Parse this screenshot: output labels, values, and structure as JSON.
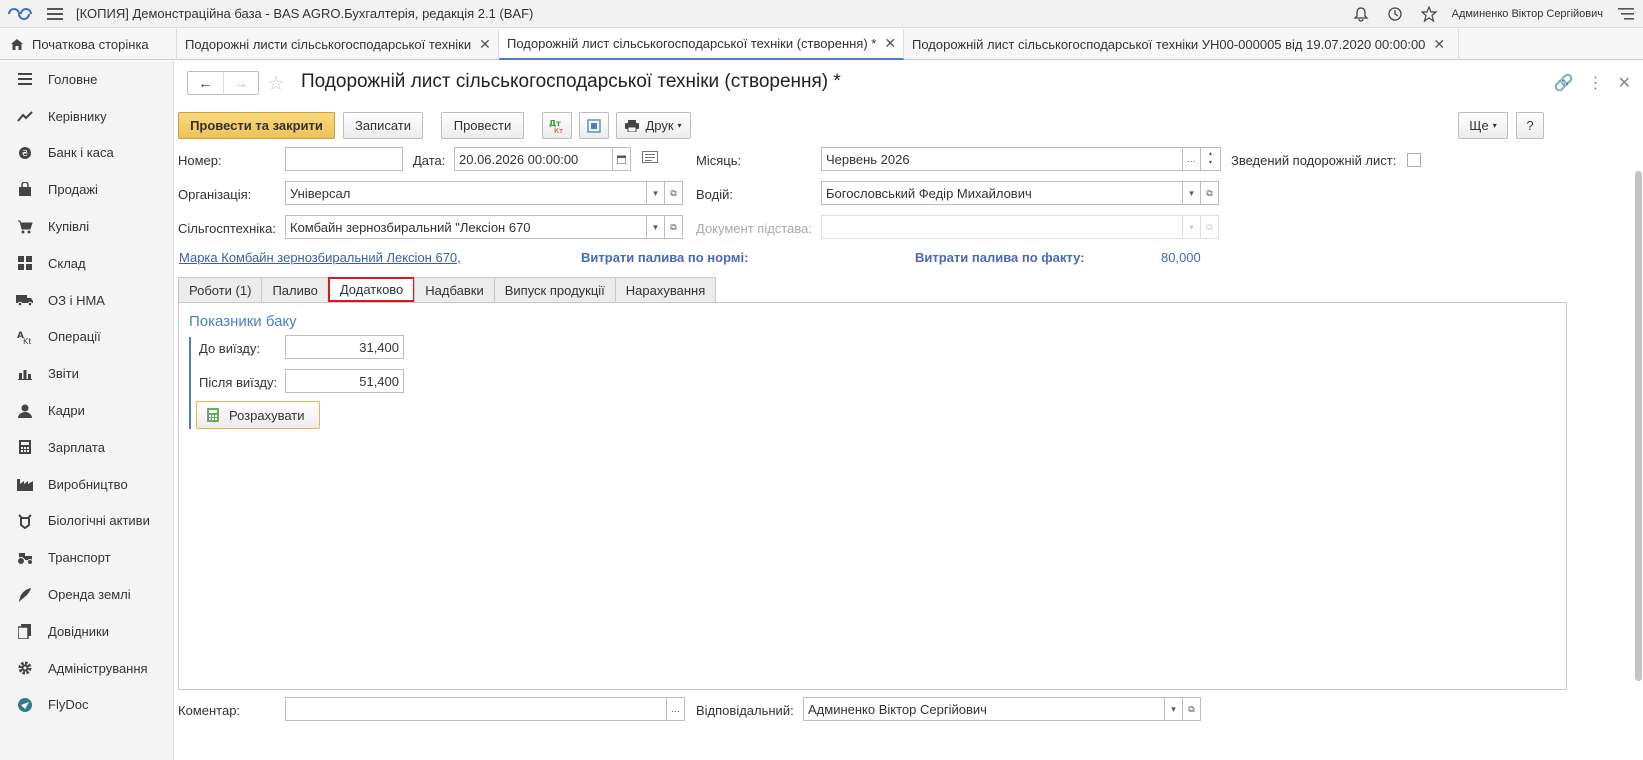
{
  "app": {
    "title": "[КОПИЯ] Демонстраційна база - BAS AGRO.Бухгалтерія, редакція 2.1  (BAF)",
    "user": "Админенко Віктор Сергійович"
  },
  "tabs": {
    "home": "Початкова сторінка",
    "items": [
      {
        "label": "Подорожні листи сільськогосподарської техніки",
        "active": false
      },
      {
        "label": "Подорожній лист сільськогосподарської техніки (створення) *",
        "active": true
      },
      {
        "label": "Подорожній лист сільськогосподарської техніки УН00-000005 від 19.07.2020 00:00:00",
        "active": false
      }
    ]
  },
  "sidebar": {
    "items": [
      {
        "label": "Головне",
        "icon": "menu-lines-icon"
      },
      {
        "label": "Керівнику",
        "icon": "trend-icon"
      },
      {
        "label": "Банк і каса",
        "icon": "coin-icon"
      },
      {
        "label": "Продажі",
        "icon": "bag-icon"
      },
      {
        "label": "Купівлі",
        "icon": "cart-icon"
      },
      {
        "label": "Склад",
        "icon": "grid-icon"
      },
      {
        "label": "ОЗ і НМА",
        "icon": "truck-icon"
      },
      {
        "label": "Операції",
        "icon": "operations-icon"
      },
      {
        "label": "Звіти",
        "icon": "bar-chart-icon"
      },
      {
        "label": "Кадри",
        "icon": "person-icon"
      },
      {
        "label": "Зарплата",
        "icon": "calculator-icon"
      },
      {
        "label": "Виробництво",
        "icon": "factory-icon"
      },
      {
        "label": "Біологічні активи",
        "icon": "cow-icon"
      },
      {
        "label": "Транспорт",
        "icon": "tractor-icon"
      },
      {
        "label": "Оренда землі",
        "icon": "feather-icon"
      },
      {
        "label": "Довідники",
        "icon": "books-icon"
      },
      {
        "label": "Адміністрування",
        "icon": "gear-icon"
      },
      {
        "label": "FlyDoc",
        "icon": "flydoc-icon"
      }
    ]
  },
  "form": {
    "title": "Подорожній лист сільськогосподарської техніки (створення) *",
    "toolbar": {
      "post_close": "Провести та закрити",
      "save": "Записати",
      "post": "Провести",
      "print": "Друк",
      "more": "Ще",
      "help": "?"
    },
    "fields": {
      "number_label": "Номер:",
      "number_value": "",
      "date_label": "Дата:",
      "date_value": "20.06.2026 00:00:00",
      "month_label": "Місяць:",
      "month_value": "Червень 2026",
      "summary_label": "Зведений подорожній лист:",
      "org_label": "Організація:",
      "org_value": "Універсал",
      "driver_label": "Водій:",
      "driver_value": "Богословський Федір Михайлович",
      "machine_label": "Сільгосптехніка:",
      "machine_value": "Комбайн зернозбиральний \"Лексіон 670",
      "basis_label": "Документ підстава:",
      "basis_value": ""
    },
    "info": {
      "brand_link": "Марка Комбайн зернозбиральний Лексіон 670, ",
      "fuel_norm_label": "Витрати палива по нормі:",
      "fuel_fact_label": "Витрати палива по факту:",
      "fuel_fact_value": "80,000"
    },
    "subtabs": [
      {
        "label": "Роботи (1)",
        "active": false
      },
      {
        "label": "Паливо",
        "active": false
      },
      {
        "label": "Додатково",
        "active": true
      },
      {
        "label": "Надбавки",
        "active": false
      },
      {
        "label": "Випуск продукції",
        "active": false
      },
      {
        "label": "Нарахування",
        "active": false
      }
    ],
    "tank": {
      "title": "Показники баку",
      "before_label": "До виїзду:",
      "before_value": "31,400",
      "after_label": "Після виїзду:",
      "after_value": "51,400",
      "calc_button": "Розрахувати"
    },
    "footer": {
      "comment_label": "Коментар:",
      "comment_value": "",
      "responsible_label": "Відповідальний:",
      "responsible_value": "Админенко Віктор Сергійович"
    }
  },
  "colors": {
    "accent": "#4a7fc1",
    "primary_button": "#f4cd6a",
    "highlight": "#d9181e",
    "link": "#3a5ea8"
  }
}
